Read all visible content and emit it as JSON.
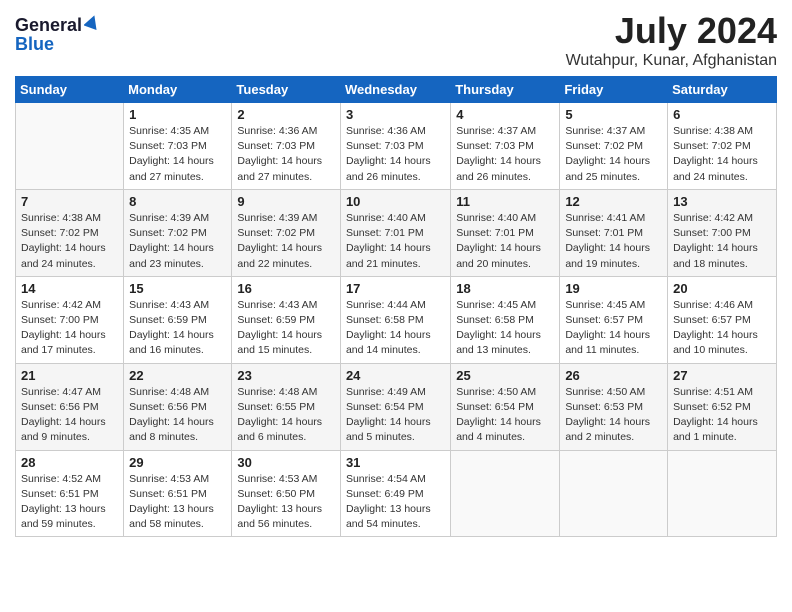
{
  "header": {
    "logo_general": "General",
    "logo_blue": "Blue",
    "month_year": "July 2024",
    "location": "Wutahpur, Kunar, Afghanistan"
  },
  "calendar": {
    "days_of_week": [
      "Sunday",
      "Monday",
      "Tuesday",
      "Wednesday",
      "Thursday",
      "Friday",
      "Saturday"
    ],
    "weeks": [
      [
        {
          "day": "",
          "detail": ""
        },
        {
          "day": "1",
          "detail": "Sunrise: 4:35 AM\nSunset: 7:03 PM\nDaylight: 14 hours and 27 minutes."
        },
        {
          "day": "2",
          "detail": "Sunrise: 4:36 AM\nSunset: 7:03 PM\nDaylight: 14 hours and 27 minutes."
        },
        {
          "day": "3",
          "detail": "Sunrise: 4:36 AM\nSunset: 7:03 PM\nDaylight: 14 hours and 26 minutes."
        },
        {
          "day": "4",
          "detail": "Sunrise: 4:37 AM\nSunset: 7:03 PM\nDaylight: 14 hours and 26 minutes."
        },
        {
          "day": "5",
          "detail": "Sunrise: 4:37 AM\nSunset: 7:02 PM\nDaylight: 14 hours and 25 minutes."
        },
        {
          "day": "6",
          "detail": "Sunrise: 4:38 AM\nSunset: 7:02 PM\nDaylight: 14 hours and 24 minutes."
        }
      ],
      [
        {
          "day": "7",
          "detail": "Sunrise: 4:38 AM\nSunset: 7:02 PM\nDaylight: 14 hours and 24 minutes."
        },
        {
          "day": "8",
          "detail": "Sunrise: 4:39 AM\nSunset: 7:02 PM\nDaylight: 14 hours and 23 minutes."
        },
        {
          "day": "9",
          "detail": "Sunrise: 4:39 AM\nSunset: 7:02 PM\nDaylight: 14 hours and 22 minutes."
        },
        {
          "day": "10",
          "detail": "Sunrise: 4:40 AM\nSunset: 7:01 PM\nDaylight: 14 hours and 21 minutes."
        },
        {
          "day": "11",
          "detail": "Sunrise: 4:40 AM\nSunset: 7:01 PM\nDaylight: 14 hours and 20 minutes."
        },
        {
          "day": "12",
          "detail": "Sunrise: 4:41 AM\nSunset: 7:01 PM\nDaylight: 14 hours and 19 minutes."
        },
        {
          "day": "13",
          "detail": "Sunrise: 4:42 AM\nSunset: 7:00 PM\nDaylight: 14 hours and 18 minutes."
        }
      ],
      [
        {
          "day": "14",
          "detail": "Sunrise: 4:42 AM\nSunset: 7:00 PM\nDaylight: 14 hours and 17 minutes."
        },
        {
          "day": "15",
          "detail": "Sunrise: 4:43 AM\nSunset: 6:59 PM\nDaylight: 14 hours and 16 minutes."
        },
        {
          "day": "16",
          "detail": "Sunrise: 4:43 AM\nSunset: 6:59 PM\nDaylight: 14 hours and 15 minutes."
        },
        {
          "day": "17",
          "detail": "Sunrise: 4:44 AM\nSunset: 6:58 PM\nDaylight: 14 hours and 14 minutes."
        },
        {
          "day": "18",
          "detail": "Sunrise: 4:45 AM\nSunset: 6:58 PM\nDaylight: 14 hours and 13 minutes."
        },
        {
          "day": "19",
          "detail": "Sunrise: 4:45 AM\nSunset: 6:57 PM\nDaylight: 14 hours and 11 minutes."
        },
        {
          "day": "20",
          "detail": "Sunrise: 4:46 AM\nSunset: 6:57 PM\nDaylight: 14 hours and 10 minutes."
        }
      ],
      [
        {
          "day": "21",
          "detail": "Sunrise: 4:47 AM\nSunset: 6:56 PM\nDaylight: 14 hours and 9 minutes."
        },
        {
          "day": "22",
          "detail": "Sunrise: 4:48 AM\nSunset: 6:56 PM\nDaylight: 14 hours and 8 minutes."
        },
        {
          "day": "23",
          "detail": "Sunrise: 4:48 AM\nSunset: 6:55 PM\nDaylight: 14 hours and 6 minutes."
        },
        {
          "day": "24",
          "detail": "Sunrise: 4:49 AM\nSunset: 6:54 PM\nDaylight: 14 hours and 5 minutes."
        },
        {
          "day": "25",
          "detail": "Sunrise: 4:50 AM\nSunset: 6:54 PM\nDaylight: 14 hours and 4 minutes."
        },
        {
          "day": "26",
          "detail": "Sunrise: 4:50 AM\nSunset: 6:53 PM\nDaylight: 14 hours and 2 minutes."
        },
        {
          "day": "27",
          "detail": "Sunrise: 4:51 AM\nSunset: 6:52 PM\nDaylight: 14 hours and 1 minute."
        }
      ],
      [
        {
          "day": "28",
          "detail": "Sunrise: 4:52 AM\nSunset: 6:51 PM\nDaylight: 13 hours and 59 minutes."
        },
        {
          "day": "29",
          "detail": "Sunrise: 4:53 AM\nSunset: 6:51 PM\nDaylight: 13 hours and 58 minutes."
        },
        {
          "day": "30",
          "detail": "Sunrise: 4:53 AM\nSunset: 6:50 PM\nDaylight: 13 hours and 56 minutes."
        },
        {
          "day": "31",
          "detail": "Sunrise: 4:54 AM\nSunset: 6:49 PM\nDaylight: 13 hours and 54 minutes."
        },
        {
          "day": "",
          "detail": ""
        },
        {
          "day": "",
          "detail": ""
        },
        {
          "day": "",
          "detail": ""
        }
      ]
    ]
  }
}
